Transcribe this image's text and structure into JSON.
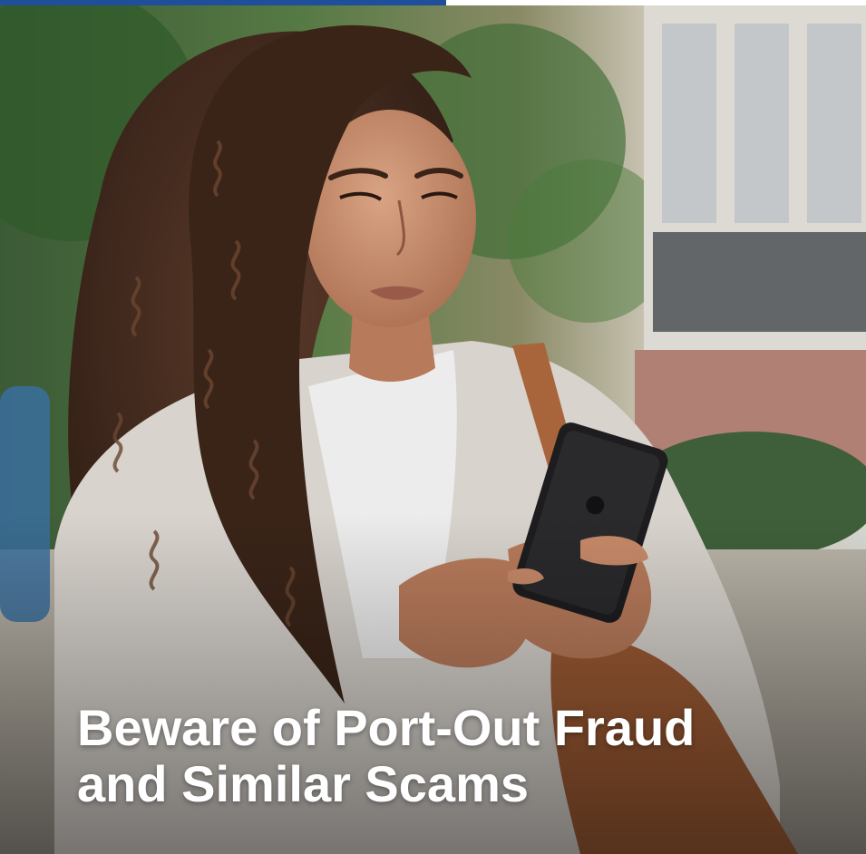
{
  "progress": {
    "fraction": 0.515,
    "color": "#1f4e9b"
  },
  "hero": {
    "image_subject": "woman with curly hair looking at smartphone outdoors",
    "headline_line1": "Beware of Port-Out Fraud",
    "headline_line2": "and Similar Scams"
  },
  "colors": {
    "accent": "#1f4e9b",
    "headline_text": "#ffffff"
  }
}
